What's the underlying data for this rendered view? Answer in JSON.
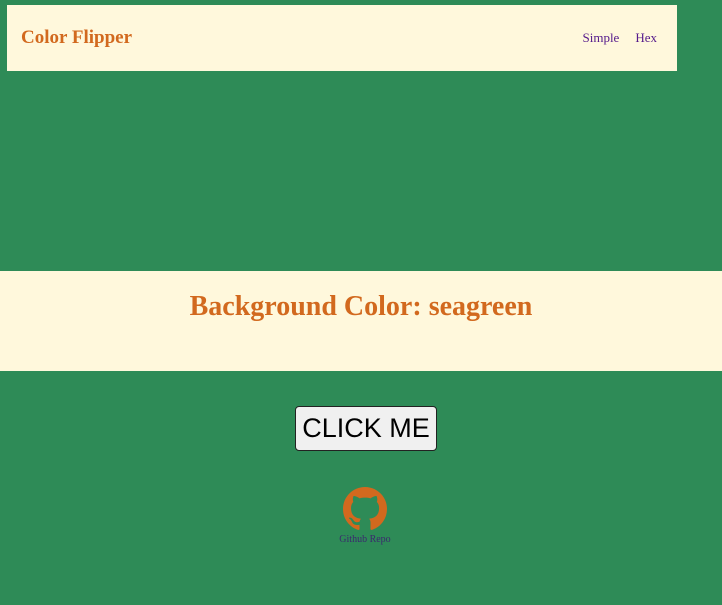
{
  "navbar": {
    "brand": "Color Flipper",
    "links": [
      {
        "label": "Simple"
      },
      {
        "label": "Hex"
      }
    ]
  },
  "banner": {
    "label": "Background Color:",
    "value": "seagreen"
  },
  "button": {
    "label": "CLICK ME"
  },
  "footer": {
    "icon": "github-icon",
    "label": "Github Repo"
  },
  "colors": {
    "background": "#2E8B57",
    "panel": "#FFF8DC",
    "accent": "#D2691E",
    "link": "#551A8B"
  }
}
